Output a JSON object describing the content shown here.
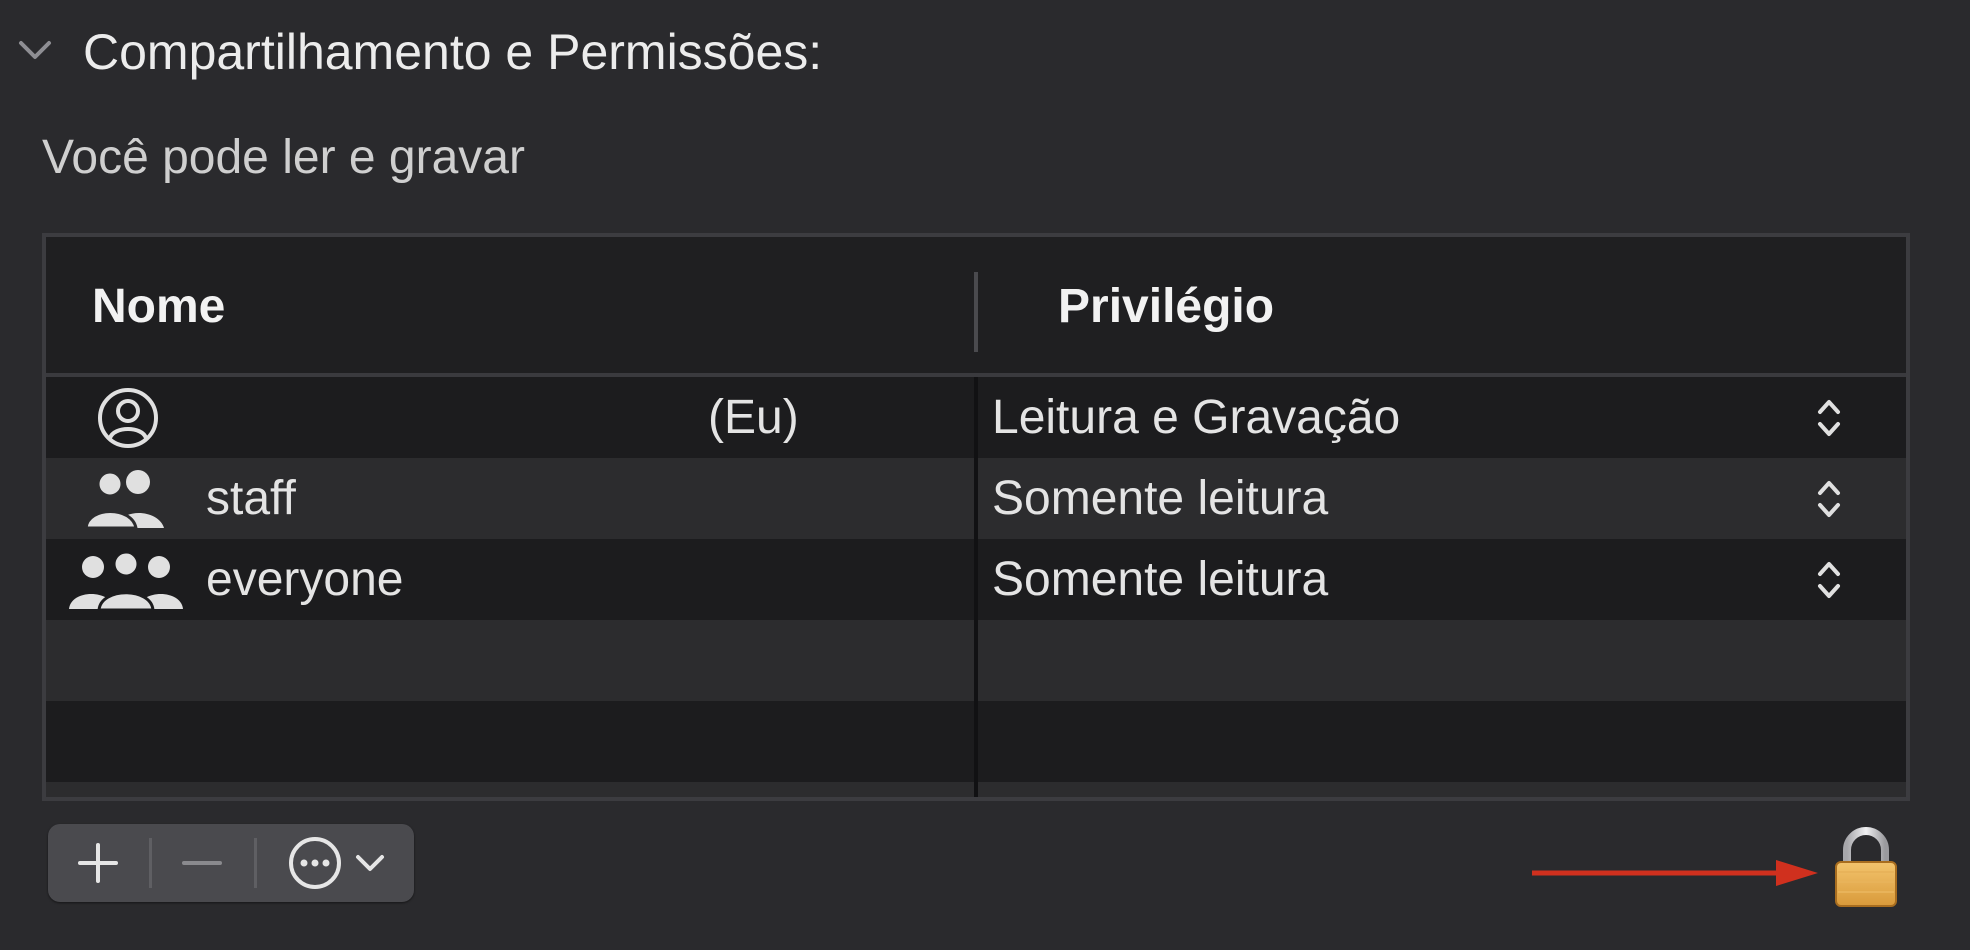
{
  "section": {
    "title": "Compartilhamento e Permissões:",
    "permission_summary": "Você pode ler e gravar"
  },
  "table": {
    "columns": [
      "Nome",
      "Privilégio"
    ],
    "rows": [
      {
        "icon": "person-circle-icon",
        "name": "",
        "tag": "(Eu)",
        "privilege": "Leitura e Gravação"
      },
      {
        "icon": "two-people-icon",
        "name": "staff",
        "tag": "",
        "privilege": "Somente leitura"
      },
      {
        "icon": "three-people-icon",
        "name": "everyone",
        "tag": "",
        "privilege": "Somente leitura"
      }
    ]
  },
  "toolbar": {
    "add_icon": "plus-icon",
    "remove_icon": "minus-icon",
    "actions_icon": "ellipsis-circle-icon",
    "actions_menu_icon": "chevron-down-icon"
  },
  "lock": {
    "icon": "padlock-icon",
    "annotation_arrow_color": "#d0301e"
  },
  "colors": {
    "background": "#2a2a2d",
    "header_background": "#1f1f21",
    "row_dark": "#1c1c1e",
    "row_light": "#2c2c2e",
    "text": "#e4e4e4"
  }
}
